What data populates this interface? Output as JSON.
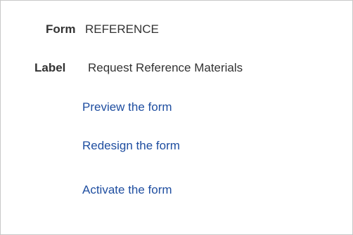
{
  "fields": {
    "form": {
      "label": "Form",
      "value": "REFERENCE"
    },
    "label": {
      "label": "Label",
      "value": "Request Reference Materials"
    }
  },
  "actions": {
    "preview": "Preview the form",
    "redesign": "Redesign the form",
    "activate": "Activate the form"
  },
  "colors": {
    "link": "#1f4ea0",
    "text": "#333333",
    "border": "#c8c8c8"
  }
}
